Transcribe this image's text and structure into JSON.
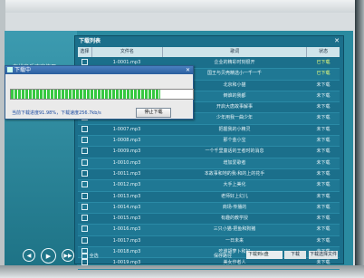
{
  "app": {
    "left_label": "在线音乐欢迎使用"
  },
  "player": {
    "prev": "◀",
    "play": "▶",
    "next": "▶▶"
  },
  "download_list": {
    "title": "下载列表",
    "close": "✕",
    "columns": [
      "选择",
      "文件名",
      "歌词",
      "状态"
    ],
    "rows": [
      {
        "file": "1-0001.mp3",
        "lyric": "企业的精彩时刻很开",
        "status": "已下载"
      },
      {
        "file": "",
        "lyric": "国王与贝壳精选小一千一千",
        "status": "已下载"
      },
      {
        "file": "",
        "lyric": "北京和小猫",
        "status": "未下载"
      },
      {
        "file": "",
        "lyric": "倒谁的我都",
        "status": "未下载"
      },
      {
        "file": "",
        "lyric": "开启大唐故事解事",
        "status": "未下载"
      },
      {
        "file": "",
        "lyric": "少年用我一曲少年",
        "status": "未下载"
      },
      {
        "file": "1-0007.mp3",
        "lyric": "把握我的小精灵",
        "status": "未下载"
      },
      {
        "file": "1-0008.mp3",
        "lyric": "那个金小宝",
        "status": "未下载"
      },
      {
        "file": "1-0009.mp3",
        "lyric": "一个千里童话的王者时的消息",
        "status": "未下载"
      },
      {
        "file": "1-0010.mp3",
        "lyric": "增加爱歌者",
        "status": "未下载"
      },
      {
        "file": "1-0011.mp3",
        "lyric": "本故事和地的我·和的上的花手",
        "status": "未下载"
      },
      {
        "file": "1-0012.mp3",
        "lyric": "大手上美化",
        "status": "未下载"
      },
      {
        "file": "1-0013.mp3",
        "lyric": "老师好上幻儿",
        "status": "未下载"
      },
      {
        "file": "1-0014.mp3",
        "lyric": "商场·传播的",
        "status": "未下载"
      },
      {
        "file": "1-0015.mp3",
        "lyric": "有趣的教学授",
        "status": "未下载"
      },
      {
        "file": "1-0016.mp3",
        "lyric": "三只小猫·把鱼和狗猪",
        "status": "未下载"
      },
      {
        "file": "1-0017.mp3",
        "lyric": "一日未来",
        "status": "未下载"
      },
      {
        "file": "1-0018.mp3",
        "lyric": "吃谁胡萝卜和好",
        "status": "未下载"
      },
      {
        "file": "1-0019.mp3",
        "lyric": "美女作者人",
        "status": "未下载"
      }
    ],
    "select_all": "全选",
    "path_label": "保存路径",
    "path_value": "下载到c盘",
    "download_button": "下载",
    "download_all_button": "下载选择文件"
  },
  "progress_dialog": {
    "title": "下载中",
    "close": "✕",
    "progress": 0.82,
    "status_text": "当前下载进度91.98%，下载速度256.7kb/s",
    "stop_button": "停止下载"
  },
  "colors": {
    "accent": "#1b6f8b",
    "progress_fill": "#36c840",
    "done_status": "#eaff7a"
  }
}
